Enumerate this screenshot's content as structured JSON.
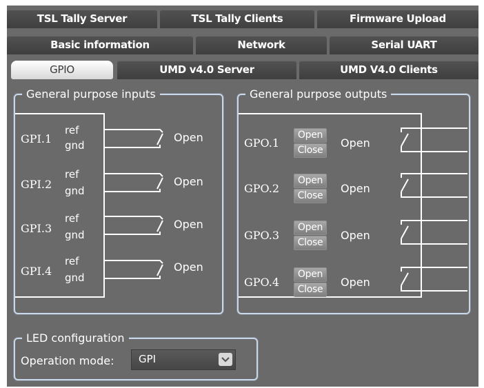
{
  "tabs": {
    "row1": [
      "TSL Tally Server",
      "TSL Tally Clients",
      "Firmware Upload"
    ],
    "row2": [
      "Basic information",
      "Network",
      "Serial UART"
    ],
    "row3": [
      "GPIO",
      "UMD v4.0 Server",
      "UMD V4.0 Clients"
    ],
    "active": "GPIO"
  },
  "inputs": {
    "title": "General purpose inputs",
    "ref": "ref",
    "gnd": "gnd",
    "items": [
      {
        "label": "GPI.1",
        "state": "Open"
      },
      {
        "label": "GPI.2",
        "state": "Open"
      },
      {
        "label": "GPI.3",
        "state": "Open"
      },
      {
        "label": "GPI.4",
        "state": "Open"
      }
    ]
  },
  "outputs": {
    "title": "General purpose outputs",
    "open_button": "Open",
    "close_button": "Close",
    "items": [
      {
        "label": "GPO.1",
        "state": "Open"
      },
      {
        "label": "GPO.2",
        "state": "Open"
      },
      {
        "label": "GPO.3",
        "state": "Open"
      },
      {
        "label": "GPO.4",
        "state": "Open"
      }
    ]
  },
  "led": {
    "title": "LED configuration",
    "mode_label": "Operation mode:",
    "mode_value": "GPI"
  },
  "colors": {
    "panel_bg": "#6a6a6a",
    "tab_bg": "#474747",
    "group_border": "#c9d8e8"
  }
}
